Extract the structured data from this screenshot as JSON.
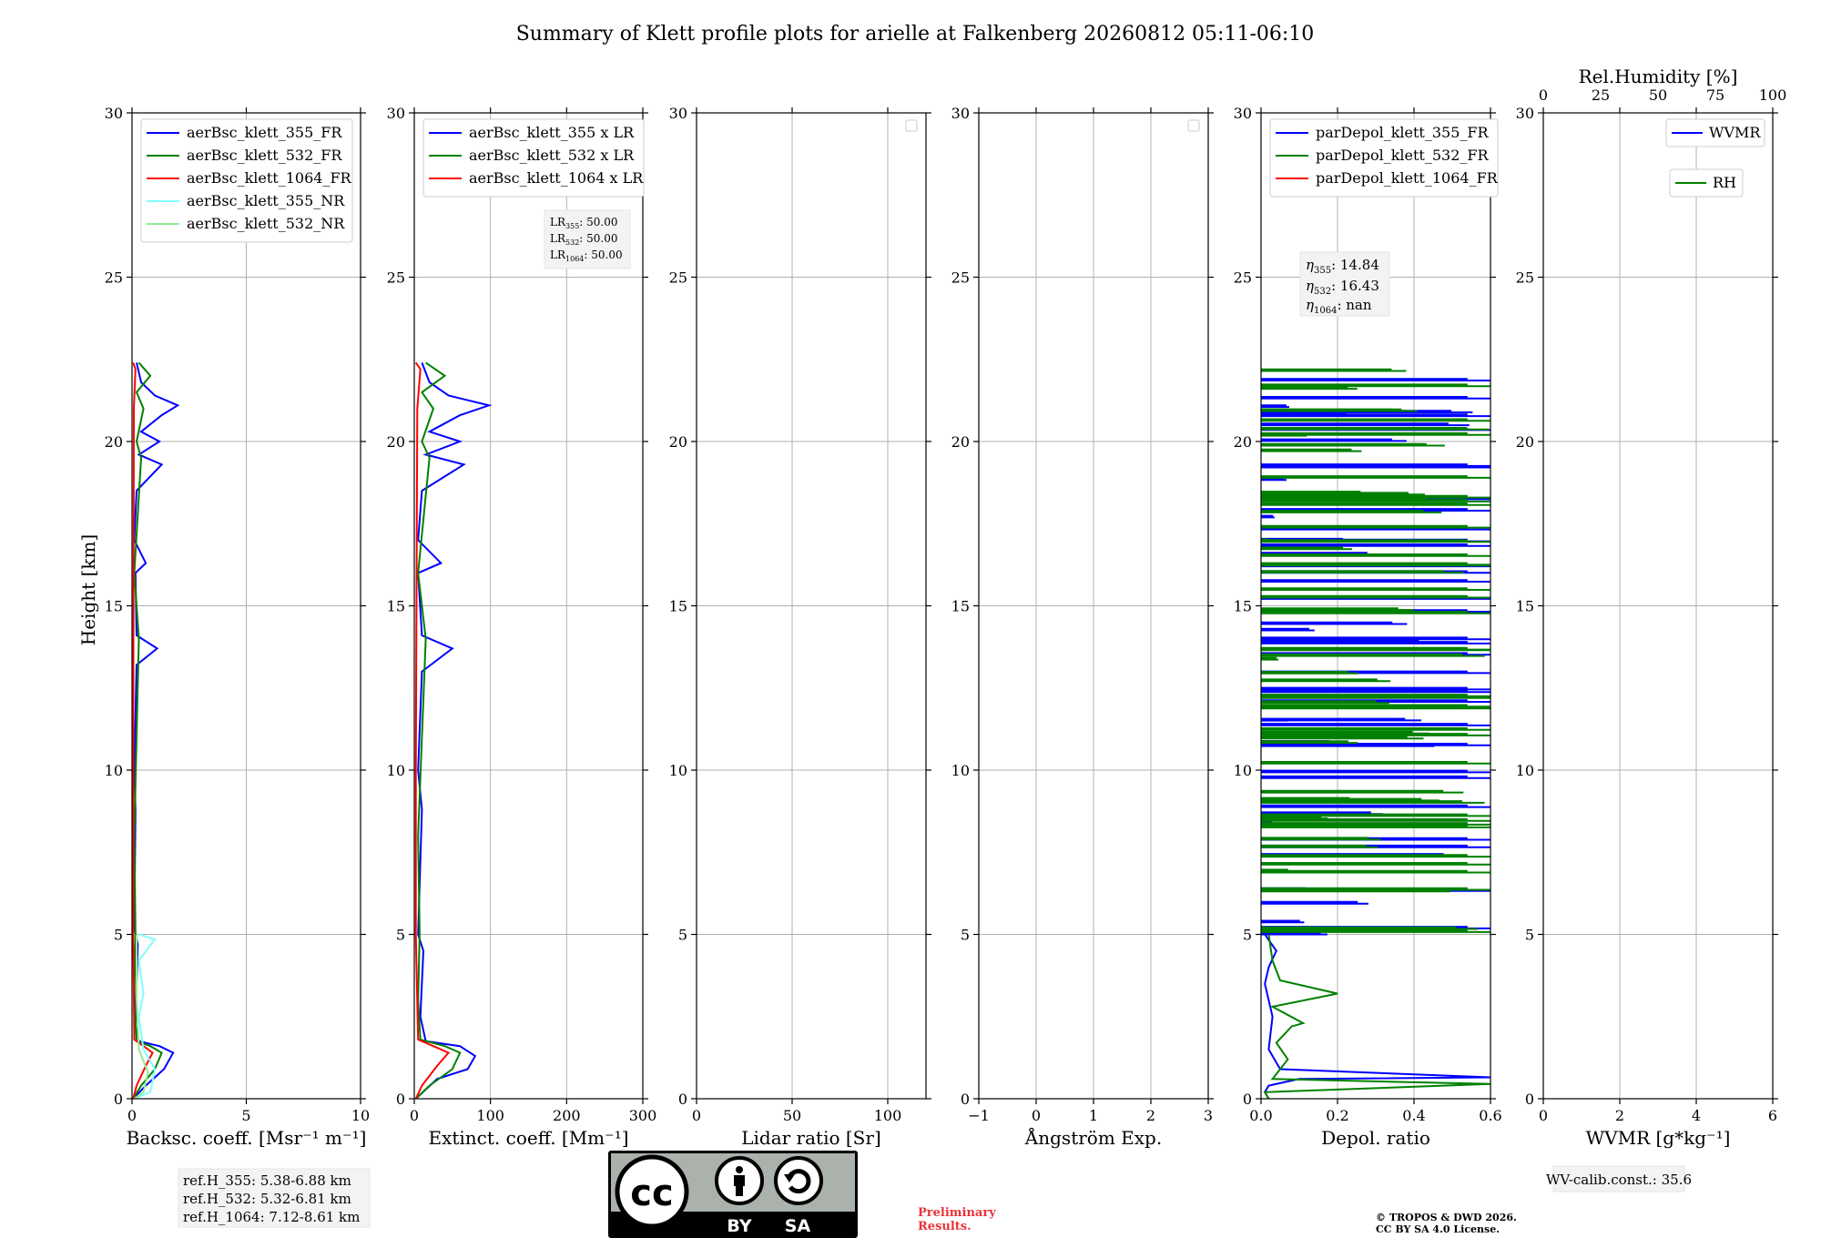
{
  "title": "Summary of Klett profile plots for arielle at Falkenberg 20260812 05:11-06:10",
  "height_axis": {
    "label": "Height [km]",
    "ylim": [
      0,
      30
    ],
    "ticks": [
      "0",
      "5",
      "10",
      "15",
      "20",
      "25",
      "30"
    ]
  },
  "colors": {
    "blue": "#0000ff",
    "green": "#008000",
    "red": "#ff0000",
    "cyan": "#7fffff",
    "lightgreen": "#90ee90",
    "red_text": "#e8343a",
    "box_bg": "#f2f3f5",
    "grid": "#b0b0b0"
  },
  "chart_data": [
    {
      "id": "backscatter",
      "type": "line",
      "xlabel": "Backsc. coeff. [Msr⁻¹ m⁻¹]",
      "xlim": [
        0,
        10
      ],
      "xticks": [
        0,
        5,
        10
      ],
      "xtick_labels": [
        "0",
        "5",
        "10"
      ],
      "legend": [
        "aerBsc_klett_355_FR",
        "aerBsc_klett_532_FR",
        "aerBsc_klett_1064_FR",
        "aerBsc_klett_355_NR",
        "aerBsc_klett_532_NR"
      ],
      "series": [
        {
          "name": "aerBsc_klett_355_FR",
          "color": "blue",
          "points": [
            [
              0.05,
              0
            ],
            [
              0.6,
              0.4
            ],
            [
              1.4,
              0.9
            ],
            [
              1.8,
              1.4
            ],
            [
              1.2,
              1.6
            ],
            [
              0.3,
              1.75
            ],
            [
              0.15,
              2.2
            ],
            [
              0.2,
              3.5
            ],
            [
              0.25,
              4.7
            ],
            [
              0.1,
              5.2
            ],
            [
              0.15,
              8.8
            ],
            [
              0.1,
              10
            ],
            [
              0.2,
              13.2
            ],
            [
              1.1,
              13.7
            ],
            [
              0.2,
              14.1
            ],
            [
              0.15,
              16
            ],
            [
              0.6,
              16.3
            ],
            [
              0.1,
              17
            ],
            [
              0.2,
              18.5
            ],
            [
              1.3,
              19.3
            ],
            [
              0.3,
              19.6
            ],
            [
              1.2,
              20
            ],
            [
              0.4,
              20.3
            ],
            [
              1.3,
              20.8
            ],
            [
              2.0,
              21.1
            ],
            [
              1.0,
              21.4
            ],
            [
              0.4,
              21.8
            ],
            [
              0.2,
              22.4
            ]
          ]
        },
        {
          "name": "aerBsc_klett_532_FR",
          "color": "green",
          "points": [
            [
              0.05,
              0
            ],
            [
              0.4,
              0.4
            ],
            [
              1.0,
              0.9
            ],
            [
              1.3,
              1.4
            ],
            [
              0.8,
              1.6
            ],
            [
              0.2,
              1.75
            ],
            [
              0.1,
              3
            ],
            [
              0.15,
              5
            ],
            [
              0.1,
              8
            ],
            [
              0.3,
              14
            ],
            [
              0.1,
              16
            ],
            [
              0.4,
              19.5
            ],
            [
              0.2,
              20
            ],
            [
              0.5,
              21
            ],
            [
              0.2,
              21.5
            ],
            [
              0.8,
              22.0
            ],
            [
              0.3,
              22.4
            ]
          ]
        },
        {
          "name": "aerBsc_klett_1064_FR",
          "color": "red",
          "points": [
            [
              0.05,
              0
            ],
            [
              0.2,
              0.4
            ],
            [
              0.6,
              1.0
            ],
            [
              0.9,
              1.4
            ],
            [
              0.5,
              1.6
            ],
            [
              0.1,
              1.8
            ],
            [
              0.05,
              5
            ],
            [
              0.05,
              10
            ],
            [
              0.08,
              21
            ],
            [
              0.15,
              22.2
            ],
            [
              0.05,
              22.4
            ]
          ]
        },
        {
          "name": "aerBsc_klett_355_NR",
          "color": "cyan",
          "points": [
            [
              0.1,
              0
            ],
            [
              0.8,
              0.2
            ],
            [
              1.0,
              0.9
            ],
            [
              0.5,
              1.5
            ],
            [
              0.3,
              2.5
            ],
            [
              0.5,
              3.2
            ],
            [
              0.3,
              4.2
            ],
            [
              1.0,
              4.85
            ],
            [
              0.3,
              5
            ]
          ]
        },
        {
          "name": "aerBsc_klett_532_NR",
          "color": "lightgreen",
          "points": [
            [
              0.1,
              0
            ],
            [
              0.5,
              0.2
            ],
            [
              0.7,
              0.8
            ],
            [
              0.3,
              1.5
            ],
            [
              0.2,
              3
            ],
            [
              0.2,
              5
            ]
          ]
        }
      ]
    },
    {
      "id": "extinction",
      "type": "line",
      "xlabel": "Extinct. coeff. [Mm⁻¹]",
      "xlim": [
        0,
        300
      ],
      "xticks": [
        0,
        100,
        200,
        300
      ],
      "xtick_labels": [
        "0",
        "100",
        "200",
        "300"
      ],
      "legend": [
        "aerBsc_klett_355 x LR",
        "aerBsc_klett_532 x LR",
        "aerBsc_klett_1064 x LR"
      ],
      "series": [
        {
          "name": "aerBsc_klett_355 x LR",
          "color": "blue",
          "points": [
            [
              2,
              0
            ],
            [
              30,
              0.6
            ],
            [
              70,
              0.9
            ],
            [
              80,
              1.3
            ],
            [
              60,
              1.6
            ],
            [
              15,
              1.75
            ],
            [
              8,
              2.5
            ],
            [
              12,
              4.5
            ],
            [
              5,
              5
            ],
            [
              10,
              8.8
            ],
            [
              5,
              10
            ],
            [
              10,
              13
            ],
            [
              50,
              13.7
            ],
            [
              10,
              14.1
            ],
            [
              5,
              16
            ],
            [
              35,
              16.3
            ],
            [
              5,
              17
            ],
            [
              10,
              18.5
            ],
            [
              65,
              19.3
            ],
            [
              15,
              19.6
            ],
            [
              60,
              20
            ],
            [
              20,
              20.3
            ],
            [
              60,
              20.8
            ],
            [
              98,
              21.1
            ],
            [
              45,
              21.4
            ],
            [
              20,
              21.8
            ],
            [
              10,
              22.4
            ]
          ]
        },
        {
          "name": "aerBsc_klett_532 x LR",
          "color": "green",
          "points": [
            [
              2,
              0
            ],
            [
              20,
              0.4
            ],
            [
              50,
              0.9
            ],
            [
              60,
              1.4
            ],
            [
              40,
              1.6
            ],
            [
              8,
              1.8
            ],
            [
              5,
              3
            ],
            [
              7,
              5
            ],
            [
              5,
              8
            ],
            [
              15,
              14
            ],
            [
              5,
              16
            ],
            [
              20,
              19.5
            ],
            [
              10,
              20
            ],
            [
              25,
              21
            ],
            [
              10,
              21.5
            ],
            [
              40,
              22
            ],
            [
              15,
              22.4
            ]
          ]
        },
        {
          "name": "aerBsc_klett_1064 x LR",
          "color": "red",
          "points": [
            [
              2,
              0
            ],
            [
              10,
              0.4
            ],
            [
              30,
              1.0
            ],
            [
              45,
              1.4
            ],
            [
              25,
              1.6
            ],
            [
              5,
              1.8
            ],
            [
              2,
              5
            ],
            [
              2,
              10
            ],
            [
              4,
              21
            ],
            [
              8,
              22.2
            ],
            [
              2,
              22.4
            ]
          ]
        }
      ]
    },
    {
      "id": "lidar_ratio",
      "type": "line",
      "xlabel": "Lidar ratio [Sr]",
      "xlim": [
        0,
        120
      ],
      "xticks": [
        0,
        50,
        100
      ],
      "xtick_labels": [
        "0",
        "50",
        "100"
      ],
      "legend": [],
      "series": []
    },
    {
      "id": "angstrom",
      "type": "line",
      "xlabel": "Ångström Exp.",
      "xlim": [
        -1,
        3
      ],
      "xticks": [
        -1,
        0,
        1,
        2,
        3
      ],
      "xtick_labels": [
        "−1",
        "0",
        "1",
        "2",
        "3"
      ],
      "legend": [],
      "series": []
    },
    {
      "id": "depol",
      "type": "line",
      "xlabel": "Depol. ratio",
      "xlim": [
        0,
        0.6
      ],
      "xticks": [
        0,
        0.2,
        0.4,
        0.6
      ],
      "xtick_labels": [
        "0.0",
        "0.2",
        "0.4",
        "0.6"
      ],
      "legend": [
        "parDepol_klett_355_FR",
        "parDepol_klett_532_FR",
        "parDepol_klett_1064_FR"
      ],
      "series": [
        {
          "name": "parDepol_klett_355_FR",
          "color": "blue",
          "points": [
            [
              0.02,
              0
            ],
            [
              0.01,
              0.2
            ],
            [
              0.02,
              0.4
            ],
            [
              0.1,
              0.6
            ],
            [
              0.6,
              0.65
            ],
            [
              0.05,
              0.9
            ],
            [
              0.02,
              1.5
            ],
            [
              0.03,
              2.5
            ],
            [
              0.01,
              3.5
            ],
            [
              0.02,
              4
            ],
            [
              0.04,
              4.5
            ],
            [
              0.01,
              5
            ]
          ],
          "spikes_range": [
            5.0,
            22.4
          ],
          "spikes_count": 55,
          "spike_max": 0.6
        },
        {
          "name": "parDepol_klett_532_FR",
          "color": "green",
          "points": [
            [
              0.02,
              0
            ],
            [
              0.01,
              0.2
            ],
            [
              0.6,
              0.45
            ],
            [
              0.03,
              0.6
            ],
            [
              0.07,
              1.2
            ],
            [
              0.04,
              1.7
            ],
            [
              0.08,
              2.2
            ],
            [
              0.11,
              2.3
            ],
            [
              0.03,
              2.8
            ],
            [
              0.2,
              3.2
            ],
            [
              0.05,
              3.6
            ],
            [
              0.03,
              4.2
            ],
            [
              0.02,
              5
            ]
          ],
          "spikes_range": [
            5.0,
            22.4
          ],
          "spikes_count": 70,
          "spike_max": 0.6
        },
        {
          "name": "parDepol_klett_1064_FR",
          "color": "red",
          "points": []
        }
      ]
    },
    {
      "id": "wvmr",
      "type": "line",
      "xlabel": "WVMR [g*kg⁻¹]",
      "xlim": [
        0,
        6
      ],
      "xticks": [
        0,
        2,
        4,
        6
      ],
      "xtick_labels": [
        "0",
        "2",
        "4",
        "6"
      ],
      "top_xlabel": "Rel.Humidity [%]",
      "top_xlim": [
        0,
        100
      ],
      "top_xticks": [
        0,
        25,
        50,
        75,
        100
      ],
      "top_xtick_labels": [
        "0",
        "25",
        "50",
        "75",
        "100"
      ],
      "legend": [
        "WVMR",
        "RH"
      ],
      "series": []
    }
  ],
  "annotations": {
    "lr": {
      "lines": [
        "LR",
        "355",
        ": 50.00",
        "LR",
        "532",
        ": 50.00",
        "LR",
        "1064",
        ": 50.00"
      ]
    },
    "eta": {
      "sym": "η",
      "sub355": "355",
      "val355": ": 14.84",
      "sub532": "532",
      "val532": ": 16.43",
      "sub1064": "1064",
      "val1064": ": nan"
    },
    "refh": [
      "ref.H_355: 5.38-6.88 km",
      "ref.H_532: 5.32-6.81 km",
      "ref.H_1064: 7.12-8.61 km"
    ],
    "wv_calib": "WV-calib.const.: 35.6",
    "preliminary": [
      "Preliminary",
      "Results."
    ],
    "copyright": [
      "© TROPOS & DWD 2026.",
      "CC BY SA 4.0 License."
    ],
    "cc_logo": {
      "text": "cc",
      "by": "BY",
      "sa": "SA"
    }
  }
}
